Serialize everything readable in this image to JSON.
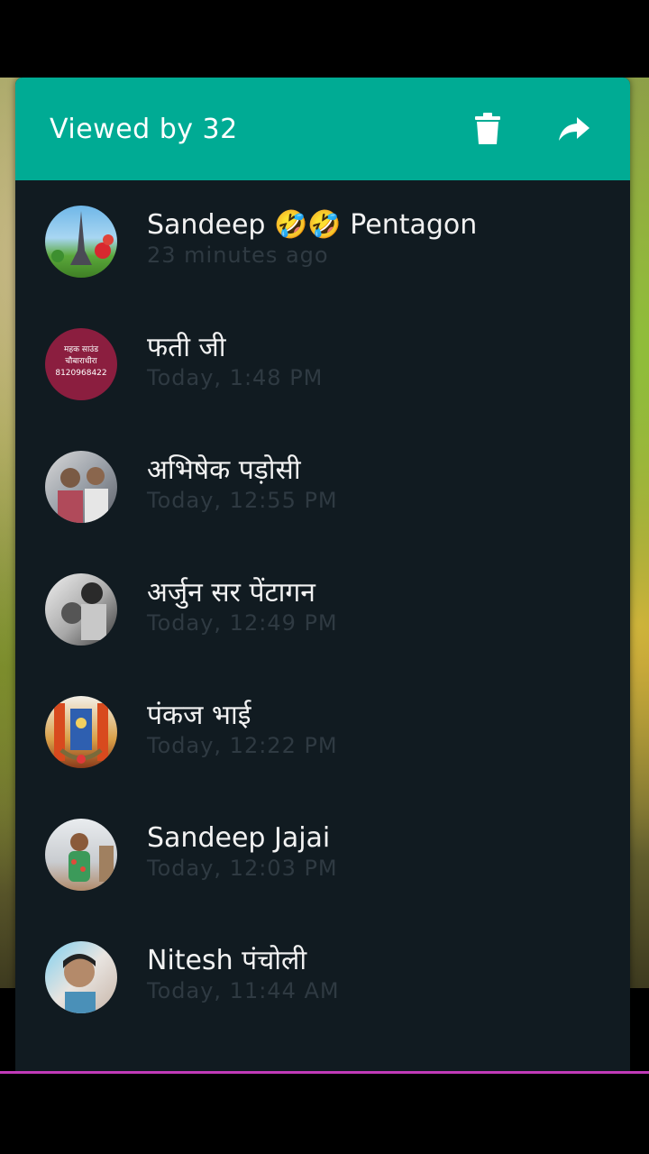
{
  "header": {
    "title": "Viewed by 32",
    "delete_icon": "trash-icon",
    "forward_icon": "share-forward-icon",
    "background_color": "#00ab94"
  },
  "viewers": [
    {
      "name": "Sandeep 🤣🤣 Pentagon",
      "time": "23 minutes ago",
      "avatar": "eiffel-tower-photo"
    },
    {
      "name": "फती जी",
      "time": "Today, 1:48 PM",
      "avatar": "sound-shop-logo",
      "avatar_text": [
        "महक साउंड",
        "चौबाराधीरा",
        "8120968422"
      ]
    },
    {
      "name": "अभिषेक पड़ोसी",
      "time": "Today, 12:55 PM",
      "avatar": "group-photo"
    },
    {
      "name": "अर्जुन सर पेंटागन",
      "time": "Today, 12:49 PM",
      "avatar": "couple-bw-photo"
    },
    {
      "name": "पंकज भाई",
      "time": "Today, 12:22 PM",
      "avatar": "temple-deity-photo"
    },
    {
      "name": "Sandeep Jajai",
      "time": "Today, 12:03 PM",
      "avatar": "child-photo"
    },
    {
      "name": "Nitesh पंचोली",
      "time": "Today, 11:44 AM",
      "avatar": "man-selfie-photo"
    }
  ],
  "colors": {
    "sheet_background": "#111b21",
    "name_text": "#f2f2f2",
    "time_text": "#2f3a42",
    "accent_line": "#c13ab8"
  }
}
